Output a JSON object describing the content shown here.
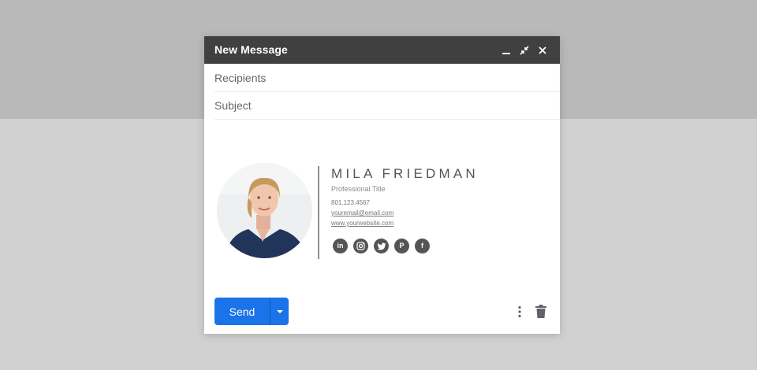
{
  "window": {
    "title": "New Message",
    "controls": [
      "minimize-icon",
      "exit-fullscreen-icon",
      "close-icon"
    ]
  },
  "fields": {
    "recipients_placeholder": "Recipients",
    "recipients_value": "",
    "subject_placeholder": "Subject",
    "subject_value": ""
  },
  "signature": {
    "name": "MILA FRIEDMAN",
    "title": "Professional Title",
    "phone": "801.123.4567",
    "email": "youremail@email.com",
    "website": "www.yourwebsite.com",
    "photo": "profile-photo",
    "socials": [
      {
        "icon": "linkedin-icon",
        "glyph": "in"
      },
      {
        "icon": "instagram-icon",
        "glyph": ""
      },
      {
        "icon": "twitter-icon",
        "glyph": ""
      },
      {
        "icon": "pinterest-icon",
        "glyph": "P"
      },
      {
        "icon": "facebook-icon",
        "glyph": "f"
      }
    ]
  },
  "footer": {
    "send_label": "Send",
    "send_options_icon": "caret-down-icon",
    "more_icon": "more-vert-icon",
    "discard_icon": "trash-icon"
  },
  "colors": {
    "accent": "#1a73e8",
    "titlebar": "#404040",
    "background_top": "#b9b9b9",
    "background_bottom": "#d1d1d1",
    "social_icon": "#555555"
  }
}
